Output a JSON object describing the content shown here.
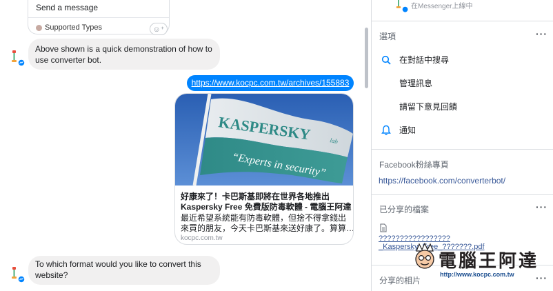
{
  "chat": {
    "top_card": {
      "row1": "Send a message",
      "row2": "Supported Types"
    },
    "msg1": "Above shown is a quick demonstration of how to use converter bot.",
    "link": "https://www.kocpc.com.tw/archives/155883",
    "preview": {
      "image_text_brand": "KASPERSKY",
      "image_text_lab": "lab",
      "image_text_slogan": "“Experts in security”",
      "title_line1": "好康來了！卡巴斯基即將在世界各地推出",
      "title_line2": "Kaspersky Free 免費版防毒軟體 - 電腦王阿達",
      "desc_line1": "最近希望系統能有防毒軟體，但捨不得拿錢出",
      "desc_line2": "來買的朋友，今天卡巴斯基來送好康了。算算…",
      "domain": "kocpc.com.tw"
    },
    "msg3": "To which format would you like to convert this website?"
  },
  "sidebar": {
    "status": "在Messenger上線中",
    "options_title": "選項",
    "options": [
      {
        "label": "在對話中搜尋",
        "icon": "search-icon"
      },
      {
        "label": "管理訊息",
        "icon": ""
      },
      {
        "label": "請留下意見回饋",
        "icon": ""
      },
      {
        "label": "通知",
        "icon": "bell-icon"
      }
    ],
    "fanpage_title": "Facebook粉絲專頁",
    "fanpage_url": "https://facebook.com/converterbot/",
    "shared_files_title": "已分享的檔案",
    "file_line1": "?????????????????",
    "file_line2": "_Kaspersky_Free_???????.pdf",
    "shared_photos_title": "分享的相片",
    "more_label": "···"
  },
  "watermark": {
    "title": "電腦王阿達",
    "url": "http://www.kocpc.com.tw"
  },
  "colors": {
    "accent": "#0084ff",
    "link": "#385898",
    "bubble": "#f1f0f0"
  }
}
